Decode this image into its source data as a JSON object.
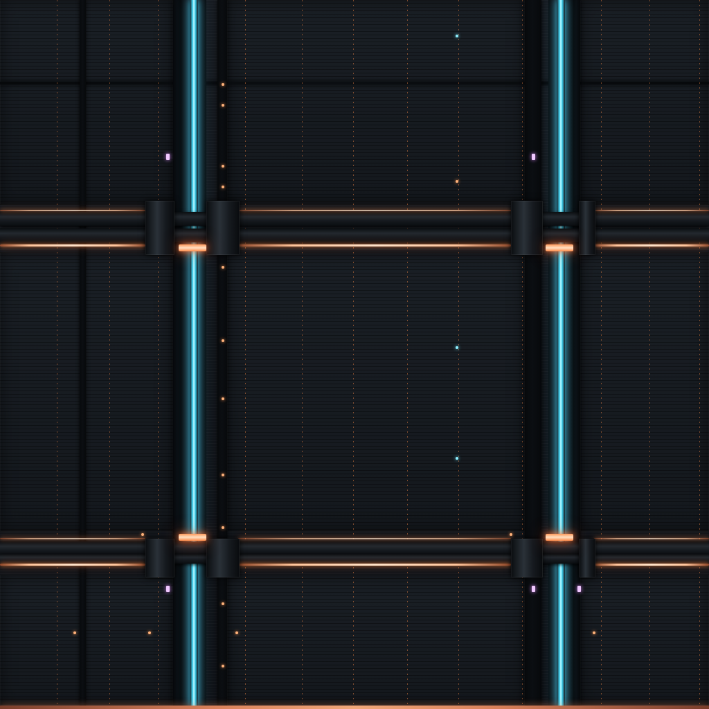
{
  "scene": {
    "accent_colors": {
      "cyan": "#3fd3f3",
      "orange": "#ff9a5c",
      "violet": "#f0c8ff",
      "panel": "#171b21"
    }
  }
}
